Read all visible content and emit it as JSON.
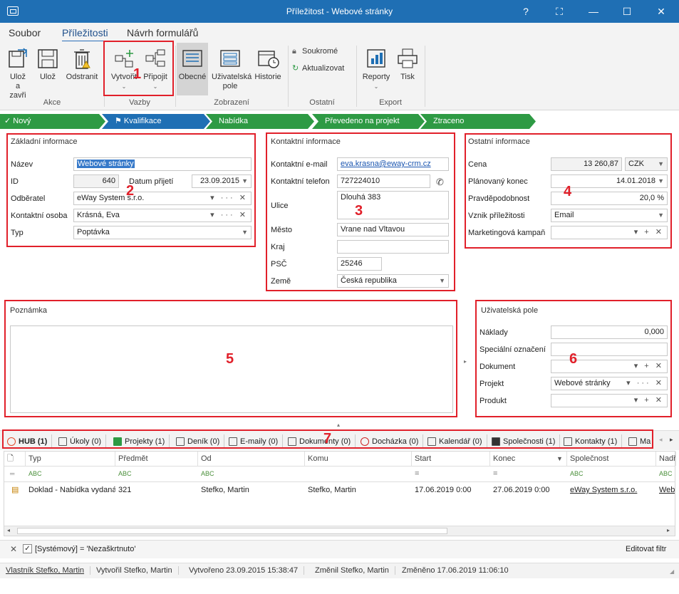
{
  "window": {
    "title": "Příležitost - Webové stránky",
    "help": "?",
    "minimize": "—",
    "maximize": "☐",
    "close": "✕"
  },
  "ribbon_tabs": [
    "Soubor",
    "Příležitosti",
    "Návrh formulářů"
  ],
  "ribbon": {
    "akce": {
      "save_close": "Ulož a zavři",
      "save": "Ulož",
      "delete": "Odstranit",
      "group": "Akce"
    },
    "vazby": {
      "create": "Vytvořit",
      "attach": "Připojit",
      "group": "Vazby"
    },
    "zobrazeni": {
      "general": "Obecné",
      "user_fields": "Uživatelská pole",
      "history": "Historie",
      "group": "Zobrazení"
    },
    "ostatni": {
      "private": "Soukromé",
      "updated": "Aktualizovat",
      "group": "Ostatní"
    },
    "export": {
      "reports": "Reporty",
      "print": "Tisk",
      "group": "Export"
    }
  },
  "stages": [
    "Nový",
    "Kvalifikace",
    "Nabídka",
    "Převedeno na projekt",
    "Ztraceno"
  ],
  "basic": {
    "title": "Základní informace",
    "name_label": "Název",
    "name": "Webové stránky",
    "id_label": "ID",
    "id": "640",
    "date_label": "Datum přijetí",
    "date": "23.09.2015",
    "customer_label": "Odběratel",
    "customer": "eWay System s.r.o.",
    "contact_label": "Kontaktní osoba",
    "contact": "Krásná, Eva",
    "type_label": "Typ",
    "type": "Poptávka"
  },
  "contact_info": {
    "title": "Kontaktní informace",
    "email_label": "Kontaktní e-mail",
    "email": "eva.krasna@eway-crm.cz",
    "phone_label": "Kontaktní telefon",
    "phone": "727224010",
    "street_label": "Ulice",
    "street": "Dlouhá 383",
    "city_label": "Město",
    "city": "Vrane nad Vltavou",
    "region_label": "Kraj",
    "region": "",
    "zip_label": "PSČ",
    "zip": "25246",
    "country_label": "Země",
    "country": "Česká republika"
  },
  "other_info": {
    "title": "Ostatní informace",
    "price_label": "Cena",
    "price": "13 260,87",
    "currency": "CZK",
    "end_label": "Plánovaný konec",
    "end": "14.01.2018",
    "prob_label": "Pravděpodobnost",
    "prob": "20,0 %",
    "origin_label": "Vznik příležitosti",
    "origin": "Email",
    "campaign_label": "Marketingová kampaň",
    "campaign": ""
  },
  "note": {
    "title": "Poznámka",
    "text": ""
  },
  "user_fields": {
    "title": "Uživatelská pole",
    "costs_label": "Náklady",
    "costs": "0,000",
    "special_label": "Speciální označení",
    "special": "",
    "document_label": "Dokument",
    "document": "",
    "project_label": "Projekt",
    "project": "Webové stránky",
    "product_label": "Produkt",
    "product": ""
  },
  "markers": [
    "1",
    "2",
    "3",
    "4",
    "5",
    "6",
    "7"
  ],
  "bottom_tabs": [
    "HUB (1)",
    "Úkoly (0)",
    "Projekty (1)",
    "Deník (0)",
    "E-maily (0)",
    "Dokumenty (0)",
    "Docházka (0)",
    "Kalendář (0)",
    "Společnosti (1)",
    "Kontakty (1)",
    "Ma"
  ],
  "grid": {
    "columns": [
      "Typ",
      "Předmět",
      "Od",
      "Komu",
      "Start",
      "Konec",
      "Společnost",
      "Nadř"
    ],
    "filter_tokens": [
      "ABC",
      "ABC",
      "ABC",
      "=",
      "=",
      "ABC",
      "ABC"
    ],
    "rows": [
      {
        "typ": "Doklad - Nabídka vydaná",
        "predmet": "321",
        "od": "Stefko, Martin",
        "komu": "Stefko, Martin",
        "start": "17.06.2019 0:00",
        "konec": "27.06.2019 0:00",
        "spolecnost": "eWay System s.r.o.",
        "nadr": "Web"
      }
    ]
  },
  "filter": {
    "text": "[Systémový] = 'Nezaškrtnuto'",
    "edit": "Editovat filtr"
  },
  "status": {
    "owner": "Vlastník Stefko, Martin",
    "created_by": "Vytvořil Stefko, Martin",
    "created": "Vytvořeno 23.09.2015 15:38:47",
    "changed_by": "Změnil Stefko, Martin",
    "changed": "Změněno 17.06.2019 11:06:10"
  }
}
